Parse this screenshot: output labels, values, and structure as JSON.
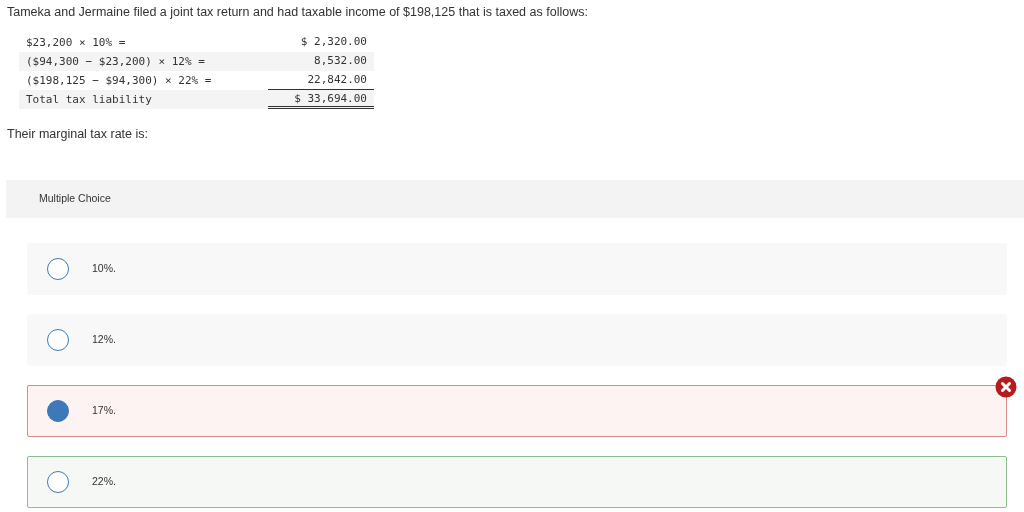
{
  "question": "Tameka and Jermaine filed a joint tax return and had taxable income of $198,125 that is taxed as follows:",
  "table": {
    "rows": [
      {
        "expression": "$23,200 × 10% =",
        "amount": "$ 2,320.00",
        "kind": "plain"
      },
      {
        "expression": "($94,300 − $23,200) × 12% =",
        "amount": "8,532.00",
        "kind": "plain"
      },
      {
        "expression": "($198,125 − $94,300) × 22% =",
        "amount": "22,842.00",
        "kind": "underlined"
      },
      {
        "expression": "Total tax liability",
        "amount": "$ 33,694.00",
        "kind": "total"
      }
    ]
  },
  "prompt": "Their marginal tax rate is:",
  "section_label": "Multiple Choice",
  "options": [
    {
      "label": "10%.",
      "selected": false,
      "kind": "plain"
    },
    {
      "label": "12%.",
      "selected": false,
      "kind": "plain"
    },
    {
      "label": "17%.",
      "selected": true,
      "kind": "incorrect"
    },
    {
      "label": "22%.",
      "selected": false,
      "kind": "correct"
    }
  ]
}
